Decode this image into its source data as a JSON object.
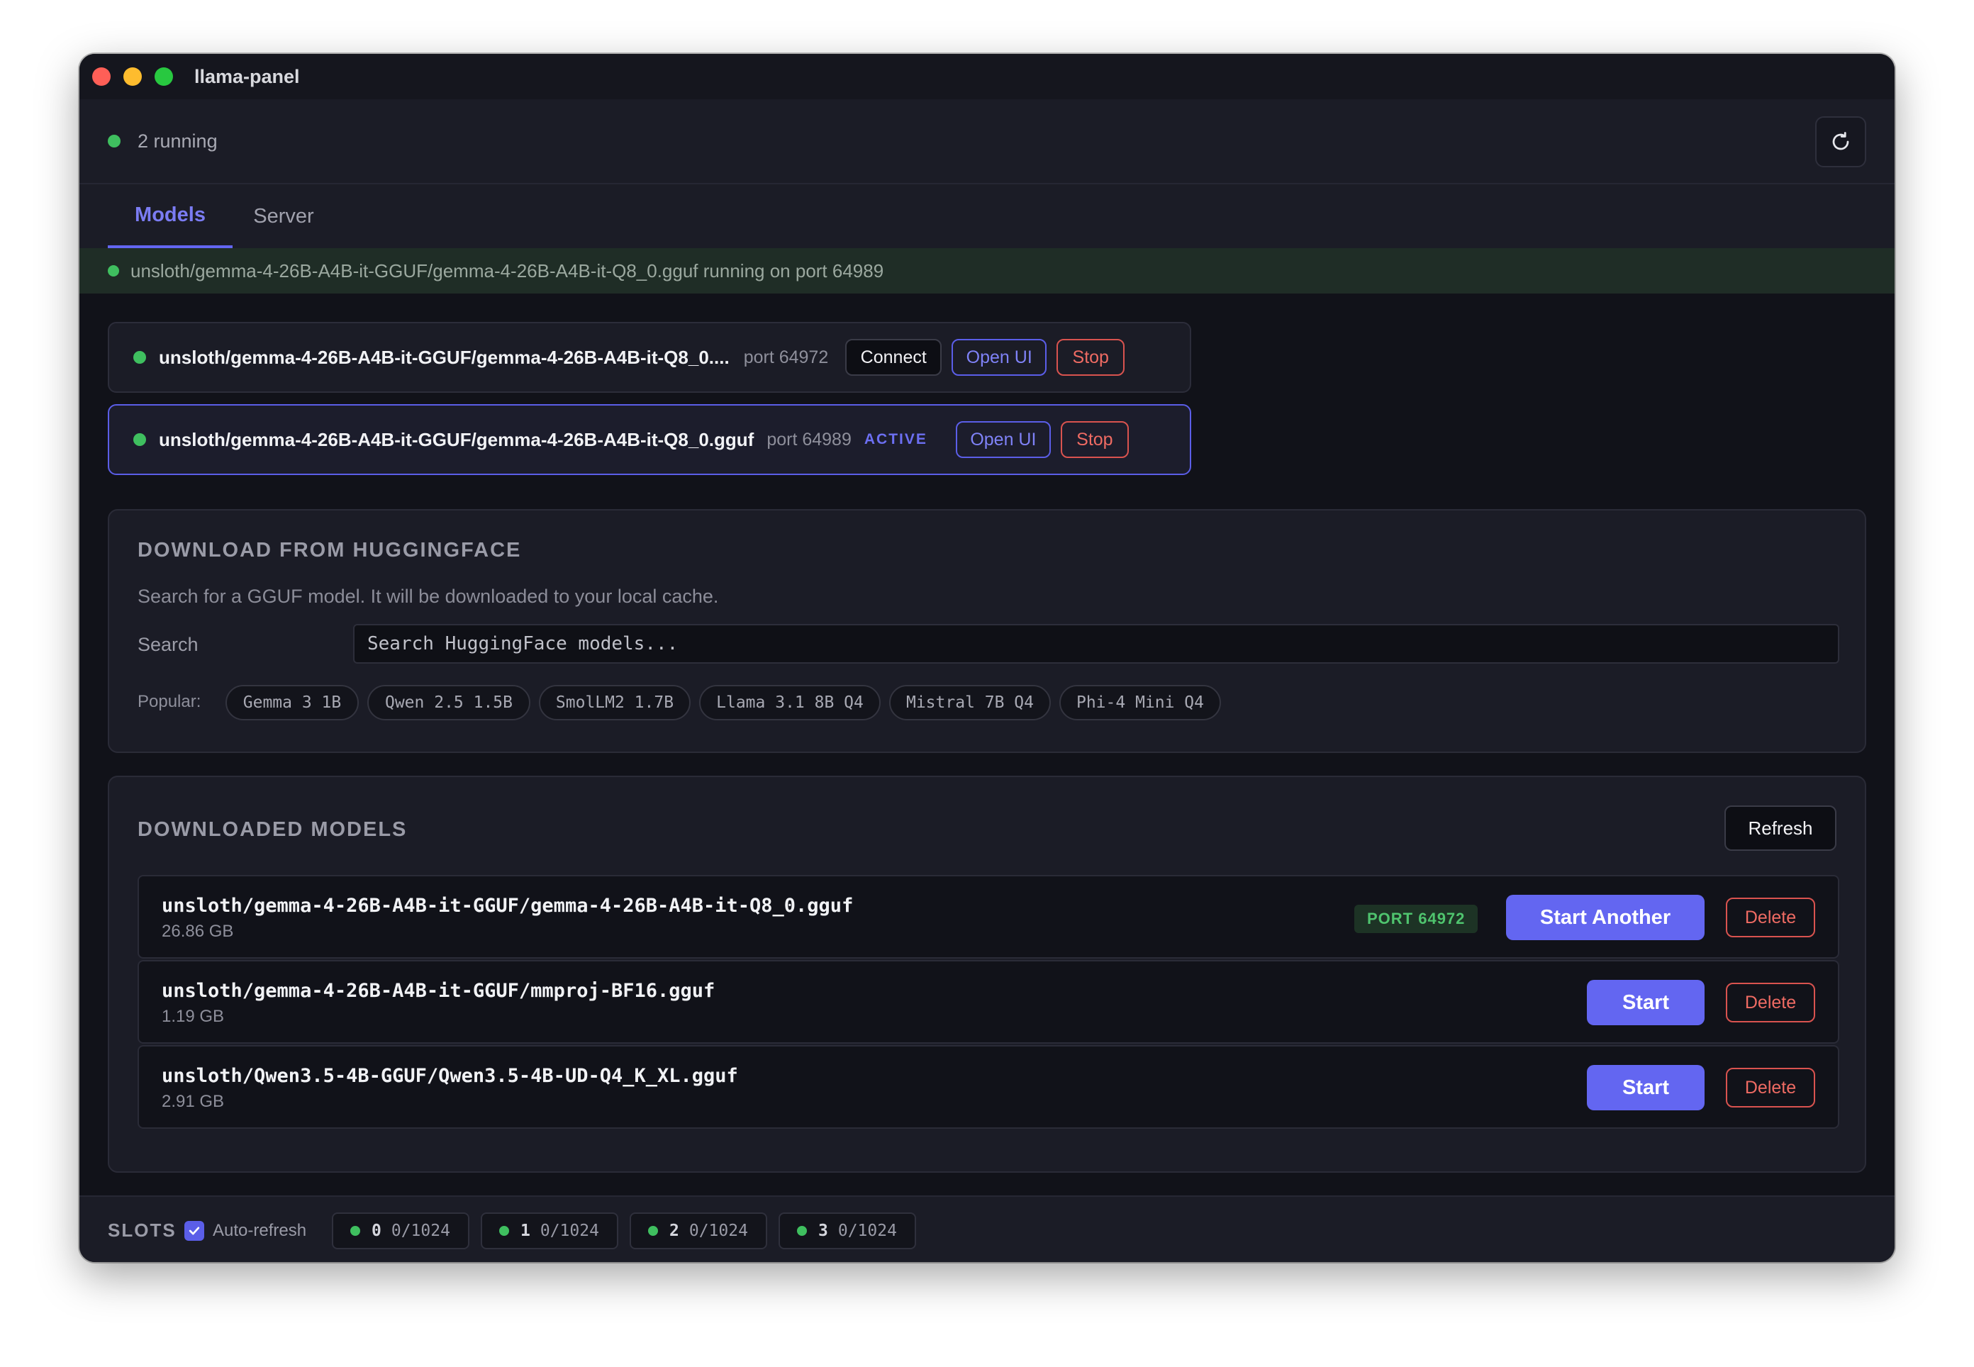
{
  "app": {
    "title": "llama-panel"
  },
  "status": {
    "text": "2 running"
  },
  "tabs": [
    {
      "label": "Models"
    },
    {
      "label": "Server"
    }
  ],
  "banner": {
    "text": "unsloth/gemma-4-26B-A4B-it-GGUF/gemma-4-26B-A4B-it-Q8_0.gguf running on port 64989"
  },
  "servers": [
    {
      "name": "unsloth/gemma-4-26B-A4B-it-GGUF/gemma-4-26B-A4B-it-Q8_0....",
      "port": "port 64972",
      "connect_label": "Connect",
      "open_label": "Open UI",
      "stop_label": "Stop"
    },
    {
      "name": "unsloth/gemma-4-26B-A4B-it-GGUF/gemma-4-26B-A4B-it-Q8_0.gguf",
      "port": "port 64989",
      "badge": "ACTIVE",
      "open_label": "Open UI",
      "stop_label": "Stop"
    }
  ],
  "download": {
    "title": "DOWNLOAD FROM HUGGINGFACE",
    "description": "Search for a GGUF model. It will be downloaded to your local cache.",
    "search_label": "Search",
    "search_placeholder": "Search HuggingFace models...",
    "popular_label": "Popular:",
    "popular": [
      "Gemma 3 1B",
      "Qwen 2.5 1.5B",
      "SmolLM2 1.7B",
      "Llama 3.1 8B Q4",
      "Mistral 7B Q4",
      "Phi-4 Mini Q4"
    ]
  },
  "downloaded": {
    "title": "DOWNLOADED MODELS",
    "refresh_label": "Refresh",
    "models": [
      {
        "name": "unsloth/gemma-4-26B-A4B-it-GGUF/gemma-4-26B-A4B-it-Q8_0.gguf",
        "size": "26.86 GB",
        "port_badge": "PORT 64972",
        "start_label": "Start Another",
        "delete_label": "Delete"
      },
      {
        "name": "unsloth/gemma-4-26B-A4B-it-GGUF/mmproj-BF16.gguf",
        "size": "1.19 GB",
        "start_label": "Start",
        "delete_label": "Delete"
      },
      {
        "name": "unsloth/Qwen3.5-4B-GGUF/Qwen3.5-4B-UD-Q4_K_XL.gguf",
        "size": "2.91 GB",
        "start_label": "Start",
        "delete_label": "Delete"
      }
    ]
  },
  "slots": {
    "label": "SLOTS",
    "auto_refresh_label": "Auto-refresh",
    "auto_refresh_checked": true,
    "items": [
      {
        "id": "0",
        "value": "0/1024"
      },
      {
        "id": "1",
        "value": "0/1024"
      },
      {
        "id": "2",
        "value": "0/1024"
      },
      {
        "id": "3",
        "value": "0/1024"
      }
    ]
  },
  "colors": {
    "accent": "#6366f1",
    "running": "#3fbf5f",
    "danger": "#ef6b63",
    "background": "#111219"
  },
  "icons": [
    "refresh-icon",
    "checkmark-icon",
    "status-dot-icon"
  ]
}
